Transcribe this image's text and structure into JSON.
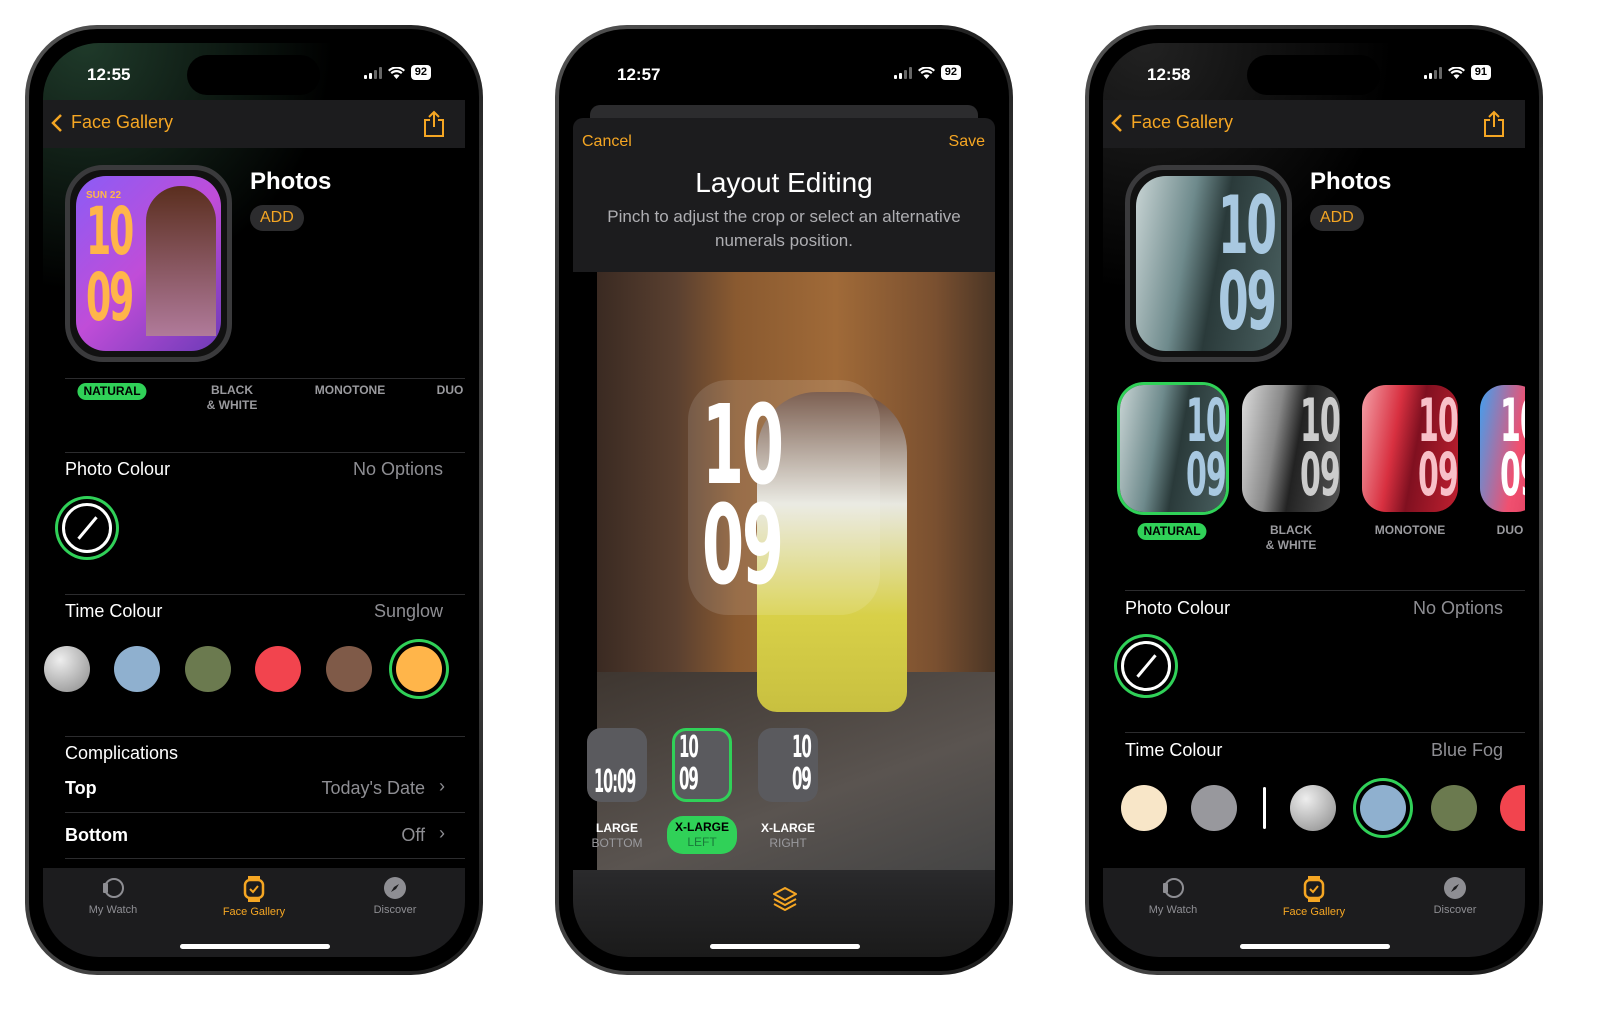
{
  "colors": {
    "accent": "#f5a623",
    "selected": "#30d158",
    "bar": "#1c1c1e"
  },
  "phone1": {
    "status": {
      "time": "12:55",
      "battery": "92"
    },
    "nav": {
      "back_label": "Face Gallery",
      "back_icon": "chevron-left-icon",
      "share_icon": "share-icon"
    },
    "face": {
      "title": "Photos",
      "add_label": "ADD",
      "watch_date": "SUN 22",
      "watch_hour": "10",
      "watch_minute": "09"
    },
    "filters": [
      {
        "label": "NATURAL",
        "selected": true
      },
      {
        "label": "BLACK\n& WHITE"
      },
      {
        "label": "MONOTONE"
      },
      {
        "label": "DUO"
      }
    ],
    "photo_colour": {
      "label": "Photo Colour",
      "value": "No Options"
    },
    "time_colour": {
      "label": "Time Colour",
      "value": "Sunglow",
      "swatches": [
        {
          "color": "silver"
        },
        {
          "color": "#8fb0cf"
        },
        {
          "color": "#6b7a4f"
        },
        {
          "color": "#f2444e"
        },
        {
          "color": "#7f5a48"
        },
        {
          "color": "#ffb54a",
          "selected": true
        }
      ]
    },
    "complications": {
      "label": "Complications",
      "top_label": "Top",
      "top_value": "Today's Date",
      "bottom_label": "Bottom",
      "bottom_value": "Off"
    },
    "tabs": [
      {
        "label": "My Watch"
      },
      {
        "label": "Face Gallery",
        "active": true
      },
      {
        "label": "Discover"
      }
    ]
  },
  "phone2": {
    "status": {
      "time": "12:57",
      "battery": "92"
    },
    "sheet": {
      "cancel_label": "Cancel",
      "save_label": "Save",
      "title": "Layout Editing",
      "subtitle": "Pinch to adjust the crop or select an alternative numerals position."
    },
    "overlay": {
      "hour": "10",
      "minute": "09"
    },
    "layouts": [
      {
        "preview": "10:09",
        "line1": "LARGE",
        "line2": "BOTTOM"
      },
      {
        "preview_top": "10",
        "preview_bottom": "09",
        "line1": "X-LARGE",
        "line2": "LEFT",
        "selected": true
      },
      {
        "preview_top": "10",
        "preview_bottom": "09",
        "line1": "X-LARGE",
        "line2": "RIGHT"
      }
    ],
    "toolbar_icon": "layers-icon"
  },
  "phone3": {
    "status": {
      "time": "12:58",
      "battery": "91"
    },
    "nav": {
      "back_label": "Face Gallery"
    },
    "face": {
      "title": "Photos",
      "add_label": "ADD",
      "watch_hour": "10",
      "watch_minute": "09"
    },
    "filters": [
      {
        "label": "NATURAL",
        "selected": true
      },
      {
        "label": "BLACK\n& WHITE"
      },
      {
        "label": "MONOTONE"
      },
      {
        "label": "DUO"
      }
    ],
    "thumb_hour": "10",
    "thumb_minute": "09",
    "photo_colour": {
      "label": "Photo Colour",
      "value": "No Options"
    },
    "time_colour": {
      "label": "Time Colour",
      "value": "Blue Fog",
      "swatches": [
        {
          "color": "#f8e6c8"
        },
        {
          "color": "#98989d"
        },
        {
          "color": "silver"
        },
        {
          "color": "#8fb0cf",
          "selected": true
        },
        {
          "color": "#6b7a4f"
        },
        {
          "color": "#f2444e"
        }
      ]
    },
    "tabs": [
      {
        "label": "My Watch"
      },
      {
        "label": "Face Gallery",
        "active": true
      },
      {
        "label": "Discover"
      }
    ]
  }
}
